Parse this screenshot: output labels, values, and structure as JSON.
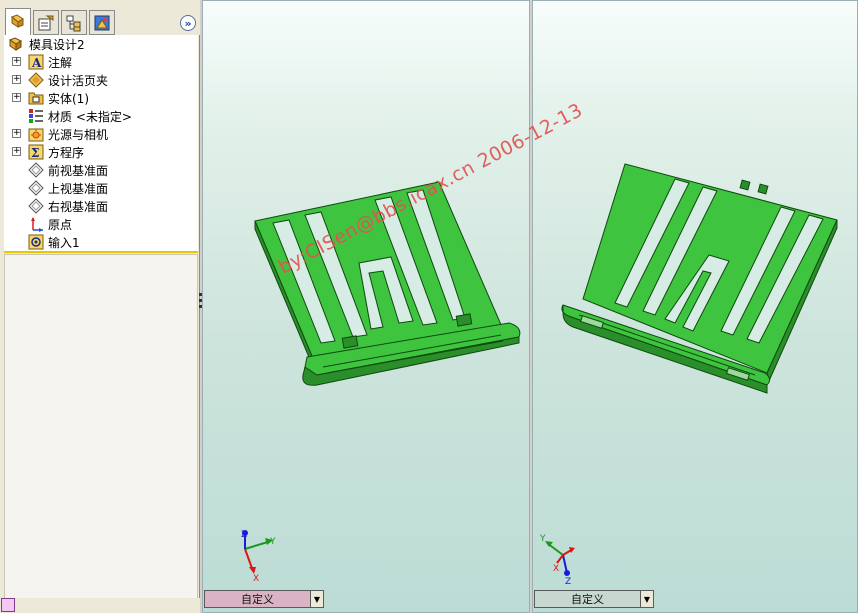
{
  "tabs": [
    {
      "name": "feature-manager-tab",
      "icon": "feature-tree-icon",
      "active": true
    },
    {
      "name": "property-manager-tab",
      "icon": "property-manager-icon",
      "active": false
    },
    {
      "name": "configuration-manager-tab",
      "icon": "configuration-manager-icon",
      "active": false
    },
    {
      "name": "display-manager-tab",
      "icon": "display-manager-icon",
      "active": false
    }
  ],
  "expand_button": "»",
  "tree": {
    "root": "模具设计2",
    "items": [
      {
        "label": "注解",
        "icon": "annotation-icon",
        "expandable": true
      },
      {
        "label": "设计活页夹",
        "icon": "design-binder-icon",
        "expandable": true
      },
      {
        "label": "实体(1)",
        "icon": "solid-bodies-icon",
        "expandable": true
      },
      {
        "label": "材质 <未指定>",
        "icon": "material-icon",
        "expandable": false
      },
      {
        "label": "光源与相机",
        "icon": "lights-cameras-icon",
        "expandable": true
      },
      {
        "label": "方程序",
        "icon": "equations-icon",
        "expandable": true
      },
      {
        "label": "前视基准面",
        "icon": "plane-icon",
        "expandable": false
      },
      {
        "label": "上视基准面",
        "icon": "plane-icon",
        "expandable": false
      },
      {
        "label": "右视基准面",
        "icon": "plane-icon",
        "expandable": false
      },
      {
        "label": "原点",
        "icon": "origin-icon",
        "expandable": false
      },
      {
        "label": "输入1",
        "icon": "import-feature-icon",
        "expandable": false
      }
    ]
  },
  "viewports": {
    "left": {
      "view_orientation": "自定义"
    },
    "right": {
      "view_orientation": "自定义"
    }
  },
  "triad_labels": {
    "x": "X",
    "y": "Y",
    "z": "Z"
  },
  "watermark": "by:CISen@bbs.icax.cn 2006-12-13",
  "colors": {
    "part": "#3ec43e",
    "part_edge": "#0e4a0e",
    "axis_x": "#d81818",
    "axis_y": "#1a9a1a",
    "axis_z": "#1a1ad8",
    "watermark": "#e25252"
  }
}
